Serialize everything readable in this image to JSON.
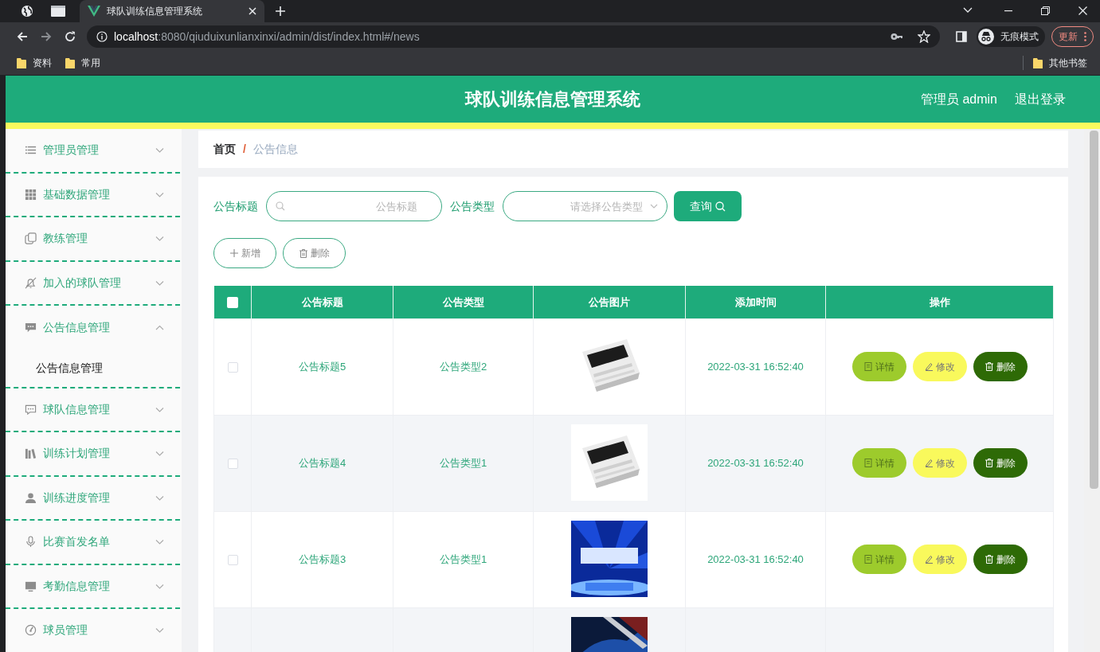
{
  "browser": {
    "tabs": [
      {
        "title": "球队训练信息管理系统",
        "selected": true
      }
    ],
    "url_host": "localhost",
    "url_path": ":8080/qiuduixunlianxinxi/admin/dist/index.html#/news",
    "profile": "无痕模式",
    "update_button": "更新",
    "bookmarks": [
      {
        "label": "资料"
      },
      {
        "label": "常用"
      }
    ],
    "other_bookmarks": "其他书签"
  },
  "header": {
    "title": "球队训练信息管理系统",
    "user": "管理员 admin",
    "logout": "退出登录"
  },
  "sidebar": {
    "items": [
      {
        "label": "管理员管理",
        "expanded": false
      },
      {
        "label": "基础数据管理",
        "expanded": false
      },
      {
        "label": "教练管理",
        "expanded": false
      },
      {
        "label": "加入的球队管理",
        "expanded": false
      },
      {
        "label": "公告信息管理",
        "expanded": true,
        "children": [
          {
            "label": "公告信息管理",
            "selected": true
          }
        ]
      },
      {
        "label": "球队信息管理",
        "expanded": false
      },
      {
        "label": "训练计划管理",
        "expanded": false
      },
      {
        "label": "训练进度管理",
        "expanded": false
      },
      {
        "label": "比赛首发名单",
        "expanded": false
      },
      {
        "label": "考勤信息管理",
        "expanded": false
      },
      {
        "label": "球员管理",
        "expanded": false
      }
    ]
  },
  "breadcrumb": {
    "items": [
      {
        "label": "首页"
      },
      {
        "label": "公告信息"
      }
    ],
    "separator": "/"
  },
  "search": {
    "fields": [
      {
        "label": "公告标题",
        "placeholder": "公告标题",
        "kind": "input"
      },
      {
        "label": "公告类型",
        "placeholder": "请选择公告类型",
        "kind": "select"
      }
    ],
    "query_button": "查询"
  },
  "toolbar": [
    {
      "label": "新增",
      "kind": "add"
    },
    {
      "label": "删除",
      "kind": "delete"
    }
  ],
  "table": {
    "header_checked": false,
    "columns": [
      "公告标题",
      "公告类型",
      "公告图片",
      "添加时间",
      "操作"
    ],
    "rows": [
      {
        "checked": false,
        "title": "公告标题5",
        "type": "公告类型2",
        "time": "2022-03-31 16:52:40",
        "actions": [
          {
            "label": "详情",
            "kind": "detail"
          },
          {
            "label": "修改",
            "kind": "edit"
          },
          {
            "label": "删除",
            "kind": "delete"
          }
        ]
      },
      {
        "checked": false,
        "title": "公告标题4",
        "type": "公告类型1",
        "time": "2022-03-31 16:52:40",
        "actions": [
          {
            "label": "详情",
            "kind": "detail"
          },
          {
            "label": "修改",
            "kind": "edit"
          },
          {
            "label": "删除",
            "kind": "delete"
          }
        ]
      },
      {
        "checked": false,
        "title": "公告标题3",
        "type": "公告类型1",
        "time": "2022-03-31 16:52:40",
        "actions": [
          {
            "label": "详情",
            "kind": "detail"
          },
          {
            "label": "修改",
            "kind": "edit"
          },
          {
            "label": "删除",
            "kind": "delete"
          }
        ]
      },
      {
        "kind": "picture"
      }
    ]
  }
}
